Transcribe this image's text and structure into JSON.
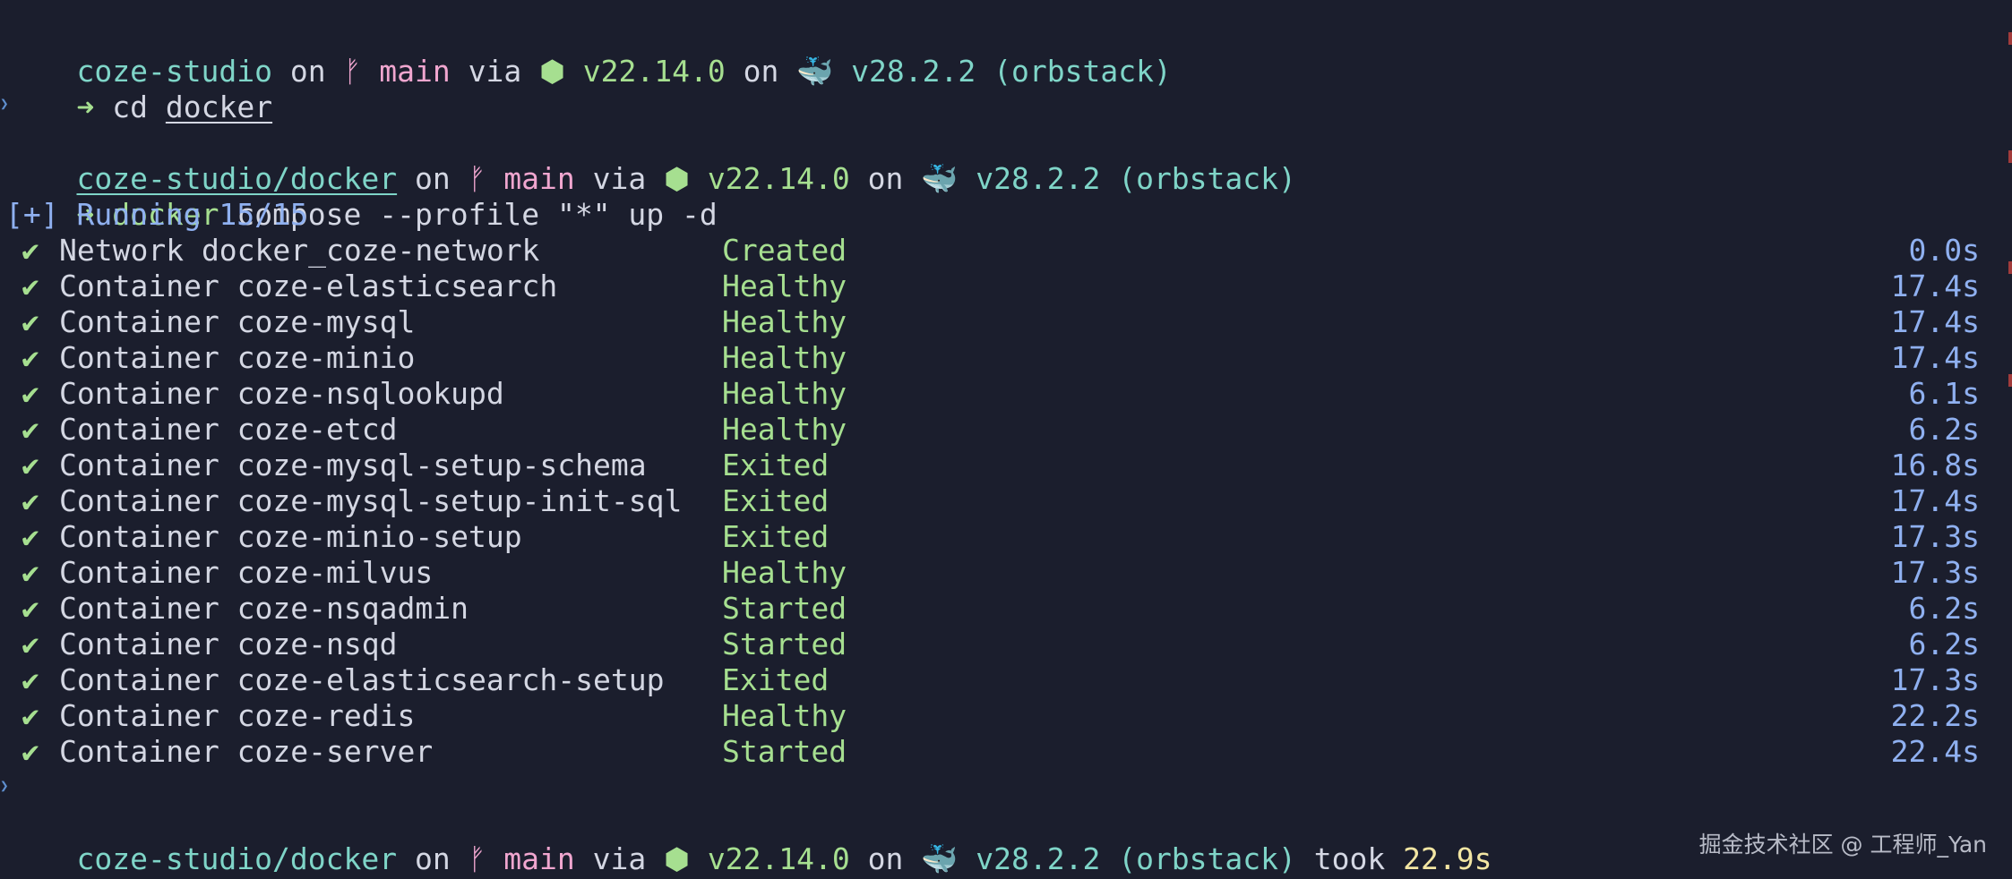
{
  "prompt1": {
    "dir": "coze-studio",
    "on": "on",
    "branch_icon": "git-branch-icon",
    "branch": "main",
    "via": "via",
    "node_icon": "node-hexagon-icon",
    "node_version": "v22.14.0",
    "on2": "on",
    "docker_icon": "docker-whale-icon",
    "docker_version": "v28.2.2",
    "docker_context": "(orbstack)"
  },
  "cmd1": {
    "arrow": "➜",
    "command": "cd",
    "arg": "docker"
  },
  "prompt2": {
    "dir": "coze-studio/docker",
    "on": "on",
    "branch": "main",
    "via": "via",
    "node_version": "v22.14.0",
    "on2": "on",
    "docker_version": "v28.2.2",
    "docker_context": "(orbstack)"
  },
  "cmd2": {
    "arrow": "➜",
    "command": "docker",
    "args": "compose --profile \"*\" up -d"
  },
  "running": "[+] Running 15/15",
  "results": [
    {
      "check": "✔",
      "name": "Network docker_coze-network",
      "status": "Created",
      "time": "0.0s"
    },
    {
      "check": "✔",
      "name": "Container coze-elasticsearch",
      "status": "Healthy",
      "time": "17.4s"
    },
    {
      "check": "✔",
      "name": "Container coze-mysql",
      "status": "Healthy",
      "time": "17.4s"
    },
    {
      "check": "✔",
      "name": "Container coze-minio",
      "status": "Healthy",
      "time": "17.4s"
    },
    {
      "check": "✔",
      "name": "Container coze-nsqlookupd",
      "status": "Healthy",
      "time": "6.1s"
    },
    {
      "check": "✔",
      "name": "Container coze-etcd",
      "status": "Healthy",
      "time": "6.2s"
    },
    {
      "check": "✔",
      "name": "Container coze-mysql-setup-schema",
      "status": "Exited",
      "time": "16.8s"
    },
    {
      "check": "✔",
      "name": "Container coze-mysql-setup-init-sql",
      "status": "Exited",
      "time": "17.4s"
    },
    {
      "check": "✔",
      "name": "Container coze-minio-setup",
      "status": "Exited",
      "time": "17.3s"
    },
    {
      "check": "✔",
      "name": "Container coze-milvus",
      "status": "Healthy",
      "time": "17.3s"
    },
    {
      "check": "✔",
      "name": "Container coze-nsqadmin",
      "status": "Started",
      "time": "6.2s"
    },
    {
      "check": "✔",
      "name": "Container coze-nsqd",
      "status": "Started",
      "time": "6.2s"
    },
    {
      "check": "✔",
      "name": "Container coze-elasticsearch-setup",
      "status": "Exited",
      "time": "17.3s"
    },
    {
      "check": "✔",
      "name": "Container coze-redis",
      "status": "Healthy",
      "time": "22.2s"
    },
    {
      "check": "✔",
      "name": "Container coze-server",
      "status": "Started",
      "time": "22.4s"
    }
  ],
  "prompt3": {
    "dir": "coze-studio/docker",
    "on": "on",
    "branch": "main",
    "via": "via",
    "node_version": "v22.14.0",
    "on2": "on",
    "docker_version": "v28.2.2",
    "docker_context": "(orbstack)",
    "took": "took",
    "duration": "22.9s"
  },
  "cmd3": {
    "arrow": "➜"
  },
  "watermark": "掘金技术社区 @ 工程师_Yan",
  "colors": {
    "background": "#1b1e2d",
    "directory": "#7fd5c8",
    "branch": "#f0a6cf",
    "success": "#a6df90",
    "timing": "#8fb0f0",
    "duration": "#f3e6a3"
  }
}
